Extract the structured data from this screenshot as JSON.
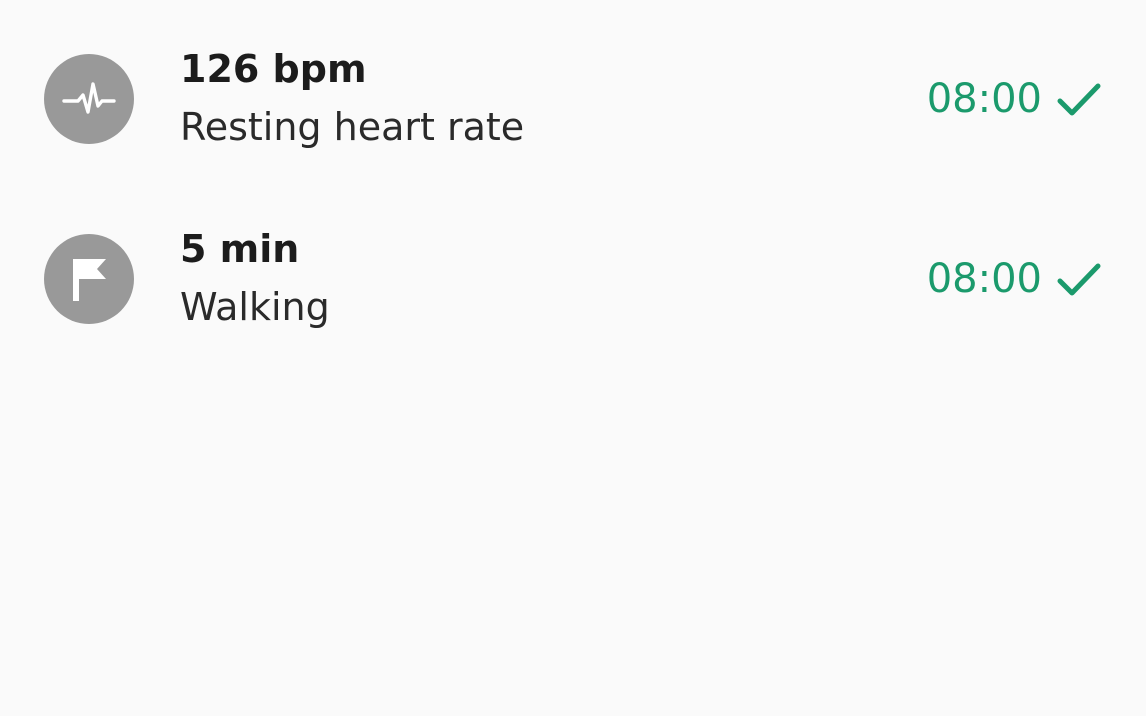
{
  "entries": [
    {
      "icon": "pulse-icon",
      "value": "126 bpm",
      "label": "Resting heart rate",
      "time": "08:00",
      "status_icon": "checkmark-icon"
    },
    {
      "icon": "flag-icon",
      "value": "5 min",
      "label": "Walking",
      "time": "08:00",
      "status_icon": "checkmark-icon"
    }
  ],
  "colors": {
    "background": "#fafafa",
    "icon_circle": "#999999",
    "accent_green": "#1b9a6c",
    "primary_text": "#1c1c1c"
  }
}
